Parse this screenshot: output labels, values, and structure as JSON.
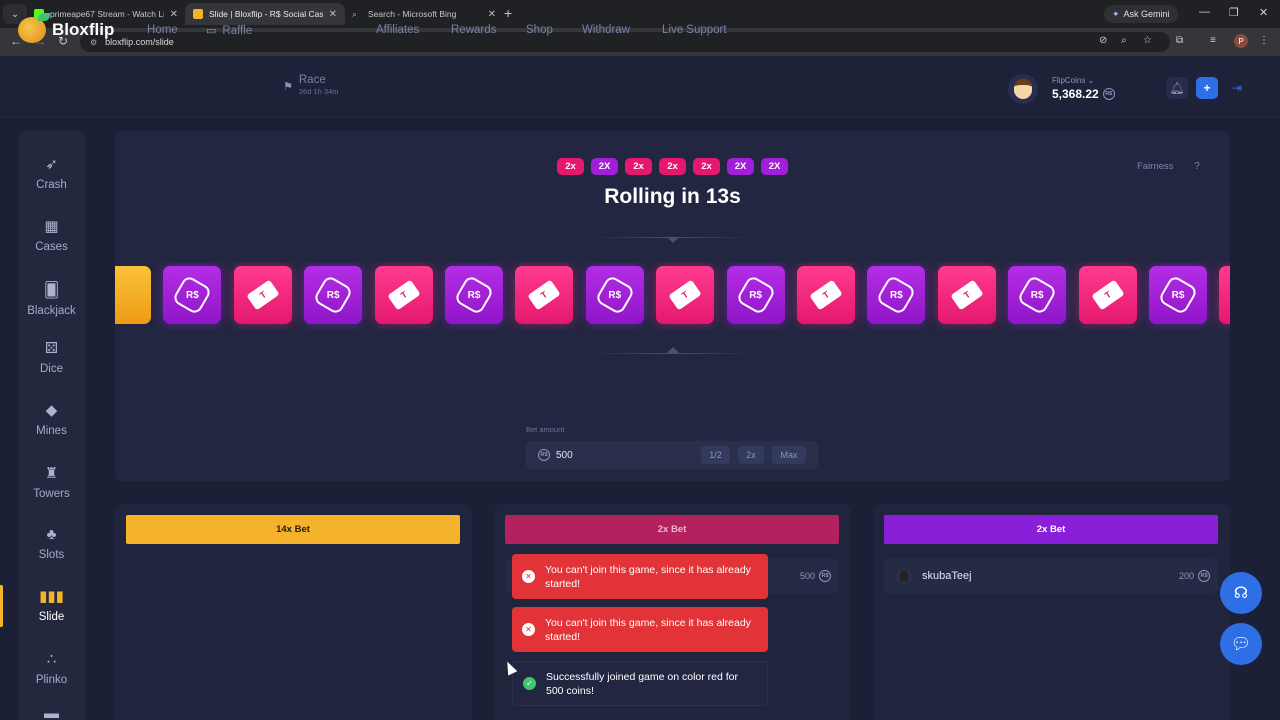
{
  "browser": {
    "tabs": [
      {
        "title": "primeape67 Stream - Watch Liv",
        "favicon_color": "#53fc18"
      },
      {
        "title": "Slide | Bloxflip - R$ Social Casino",
        "favicon_color": "#f4b32b"
      },
      {
        "title": "Search - Microsoft Bing",
        "favicon_color": "#3a7bd5"
      }
    ],
    "gemini_label": "Ask Gemini",
    "url": "bloxflip.com/slide",
    "profile_initial": "P"
  },
  "header": {
    "logo_text": "Bloxflip",
    "nav": [
      "Home",
      "Raffle",
      "Race",
      "Affiliates",
      "Rewards",
      "Shop",
      "Withdraw",
      "Live Support"
    ],
    "race_timer": "26d 1h 34m",
    "coins_label": "FlipCoins",
    "coins_value": "5,368.22"
  },
  "sidebar": {
    "items": [
      {
        "label": "Crash",
        "icon": "rocket-icon"
      },
      {
        "label": "Cases",
        "icon": "case-icon"
      },
      {
        "label": "Blackjack",
        "icon": "cards-icon"
      },
      {
        "label": "Dice",
        "icon": "dice-icon"
      },
      {
        "label": "Mines",
        "icon": "gem-icon"
      },
      {
        "label": "Towers",
        "icon": "tower-icon"
      },
      {
        "label": "Slots",
        "icon": "slots-icon"
      },
      {
        "label": "Slide",
        "icon": "slide-icon"
      },
      {
        "label": "Plinko",
        "icon": "plinko-icon"
      }
    ],
    "active": "Slide"
  },
  "game": {
    "history": [
      "2x",
      "2X",
      "2x",
      "2x",
      "2x",
      "2X",
      "2X"
    ],
    "history_colors": [
      "#e4186e",
      "#a21fd9",
      "#e4186e",
      "#e4186e",
      "#e4186e",
      "#a21fd9",
      "#a21fd9"
    ],
    "status": "Rolling in 13s",
    "fairness_label": "Fairness",
    "help_label": "?",
    "reel": [
      "gold",
      "purple",
      "red",
      "purple",
      "red",
      "purple",
      "red",
      "purple",
      "red",
      "purple",
      "red",
      "purple",
      "red",
      "purple",
      "red",
      "purple",
      "red"
    ],
    "rs_label": "R$"
  },
  "bet": {
    "label": "Bet amount",
    "value": "500",
    "options": [
      "1/2",
      "2x",
      "Max"
    ]
  },
  "columns": [
    {
      "button": "14x Bet",
      "color": "#f4b32b",
      "rows": []
    },
    {
      "button": "2x Bet",
      "color": "#b3215f",
      "rows": [
        {
          "user": "",
          "amount": "500"
        }
      ]
    },
    {
      "button": "2x Bet",
      "color": "#8a1fd9",
      "rows": [
        {
          "user": "skubaTeej",
          "amount": "200"
        }
      ]
    }
  ],
  "toasts": [
    {
      "type": "error",
      "text": "You can't join this game, since it has already started!"
    },
    {
      "type": "error",
      "text": "You can't join this game, since it has already started!"
    },
    {
      "type": "ok",
      "text": "Successfully joined game on color red for 500 coins!"
    }
  ]
}
